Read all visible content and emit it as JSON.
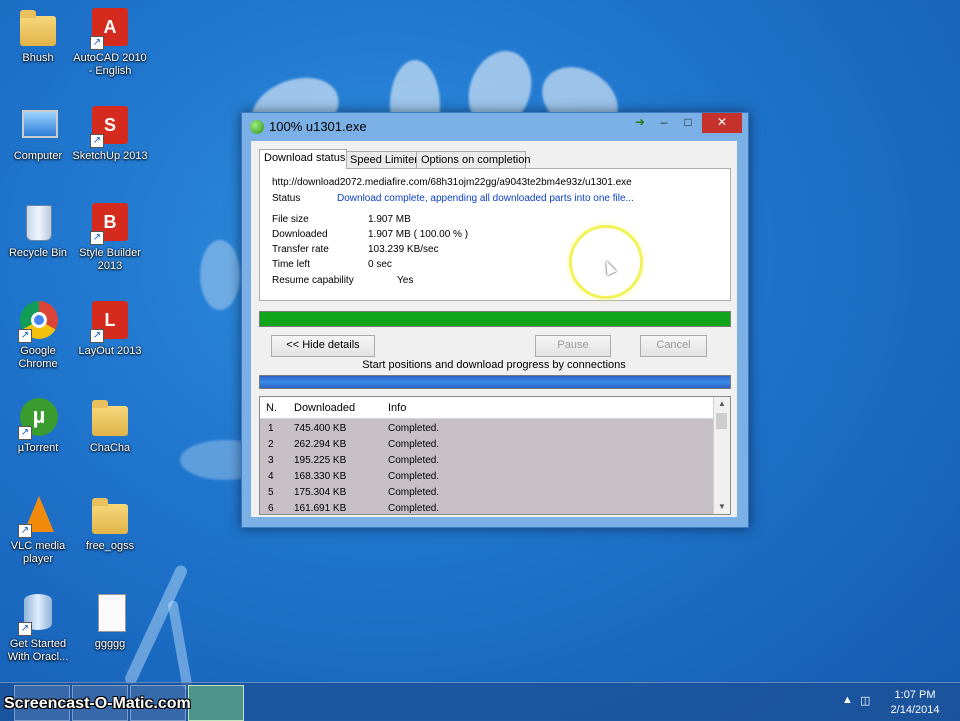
{
  "desktop": {
    "icons": [
      {
        "label": "Bhush",
        "icon": "user-folder-icon"
      },
      {
        "label": "AutoCAD 2010 - English",
        "icon": "autocad-icon"
      },
      {
        "label": "Computer",
        "icon": "computer-icon"
      },
      {
        "label": "SketchUp 2013",
        "icon": "sketchup-icon"
      },
      {
        "label": "Recycle Bin",
        "icon": "recycle-bin-icon"
      },
      {
        "label": "Style Builder 2013",
        "icon": "style-builder-icon"
      },
      {
        "label": "Google Chrome",
        "icon": "chrome-icon"
      },
      {
        "label": "LayOut 2013",
        "icon": "layout-icon"
      },
      {
        "label": "µTorrent",
        "icon": "utorrent-icon"
      },
      {
        "label": "ChaCha",
        "icon": "folder-icon"
      },
      {
        "label": "VLC media player",
        "icon": "vlc-icon"
      },
      {
        "label": "free_ogss",
        "icon": "folder-icon"
      },
      {
        "label": "Get Started With Oracl...",
        "icon": "oracle-xe-icon"
      },
      {
        "label": "ggggg",
        "icon": "document-icon"
      }
    ]
  },
  "window": {
    "title": "100% u1301.exe",
    "tabs": [
      "Download status",
      "Speed Limiter",
      "Options on completion"
    ],
    "url": "http://download2072.mediafire.com/68h31ojm22gg/a9043te2bm4e93z/u1301.exe",
    "status_label": "Status",
    "status_value": "Download complete, appending all downloaded parts into one file...",
    "fields": [
      {
        "label": "File size",
        "value": "1.907  MB"
      },
      {
        "label": "Downloaded",
        "value": "1.907  MB  ( 100.00 % )"
      },
      {
        "label": "Transfer rate",
        "value": "103.239  KB/sec"
      },
      {
        "label": "Time left",
        "value": "0 sec"
      },
      {
        "label": "Resume capability",
        "value": "Yes"
      }
    ],
    "progress_percent": 100,
    "buttons": {
      "hide_details": "<< Hide details",
      "pause": "Pause",
      "cancel": "Cancel"
    },
    "connections_caption": "Start positions and download progress by connections",
    "table": {
      "headers": [
        "N.",
        "Downloaded",
        "Info"
      ],
      "rows": [
        {
          "n": "1",
          "downloaded": "745.400  KB",
          "info": "Completed."
        },
        {
          "n": "2",
          "downloaded": "262.294  KB",
          "info": "Completed."
        },
        {
          "n": "3",
          "downloaded": "195.225  KB",
          "info": "Completed."
        },
        {
          "n": "4",
          "downloaded": "168.330  KB",
          "info": "Completed."
        },
        {
          "n": "5",
          "downloaded": "175.304  KB",
          "info": "Completed."
        },
        {
          "n": "6",
          "downloaded": "161.691  KB",
          "info": "Completed."
        }
      ]
    }
  },
  "taskbar": {
    "watermark": "Screencast-O-Matic.com",
    "time": "1:07 PM",
    "date": "2/14/2014"
  }
}
